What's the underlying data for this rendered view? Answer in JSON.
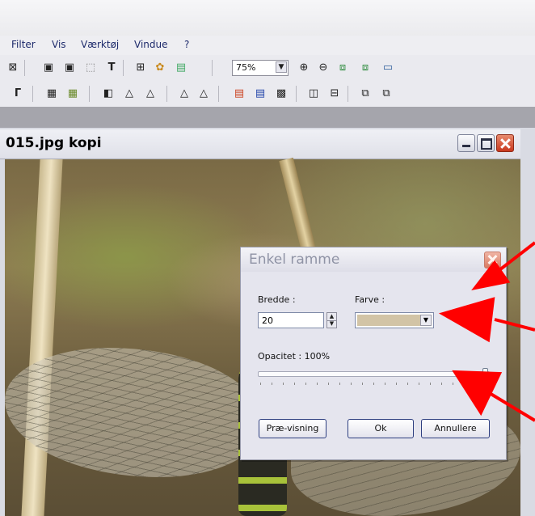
{
  "menu": [
    "Filter",
    "Vis",
    "Værktøj",
    "Vindue",
    "?"
  ],
  "toolbar": {
    "zoom_value": "75%"
  },
  "document": {
    "title": "015.jpg kopi"
  },
  "dialog": {
    "title": "Enkel ramme",
    "width_label": "Bredde :",
    "width_value": "20",
    "color_label": "Farve :",
    "color_value": "#d2c4a6",
    "opacity_label": "Opacitet : 100%",
    "opacity_value": 100,
    "preview_button": "Præ-visning",
    "ok_button": "Ok",
    "cancel_button": "Annullere"
  },
  "icons": {
    "toolbar1": [
      "crop-icon",
      "image-icon",
      "image-edit-icon",
      "selection-icon",
      "text-icon",
      "tree-icon",
      "paint-icon",
      "window-icon",
      "zoom-in-icon",
      "zoom-out-icon",
      "fit-window-icon",
      "actual-size-icon",
      "screen-icon"
    ],
    "toolbar2": [
      "gamma-icon",
      "grid-icon",
      "grid-color-icon",
      "contrast-icon",
      "brightness-icon",
      "levels-icon",
      "sharpen-icon",
      "sharpen-more-icon",
      "color-balance-icon",
      "hue-icon",
      "effect-icon",
      "flip-icon",
      "rotate-icon",
      "resize-icon",
      "canvas-icon"
    ]
  },
  "colors": {
    "arrow": "#ff0000",
    "close_button": "#d9471f"
  }
}
